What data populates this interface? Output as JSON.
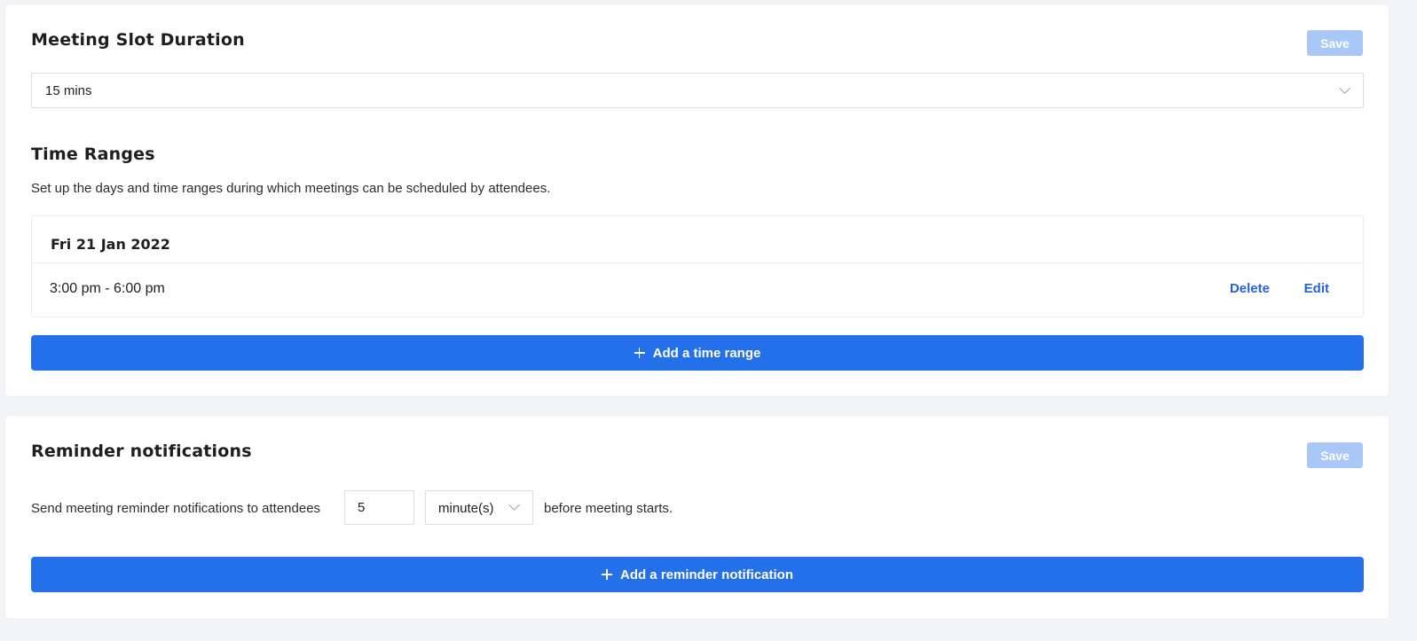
{
  "slot_duration": {
    "title": "Meeting Slot Duration",
    "save_label": "Save",
    "selected_value": "15 mins"
  },
  "time_ranges": {
    "title": "Time Ranges",
    "description": "Set up the days and time ranges during which meetings can be scheduled by attendees.",
    "entries": [
      {
        "date": "Fri 21 Jan 2022",
        "time": "3:00 pm - 6:00 pm",
        "delete_label": "Delete",
        "edit_label": "Edit"
      }
    ],
    "add_label": "Add a time range"
  },
  "reminders": {
    "title": "Reminder notifications",
    "save_label": "Save",
    "text_before": "Send meeting reminder notifications to attendees",
    "amount": "5",
    "unit": "minute(s)",
    "text_after": "before meeting starts.",
    "add_label": "Add a reminder notification"
  },
  "colors": {
    "primary": "#2470ea",
    "save_disabled": "#a9c7f7",
    "link": "#2563d9",
    "background": "#f3f4f8"
  },
  "icons": {
    "add": "plus-icon",
    "dropdown": "chevron-down-icon"
  }
}
